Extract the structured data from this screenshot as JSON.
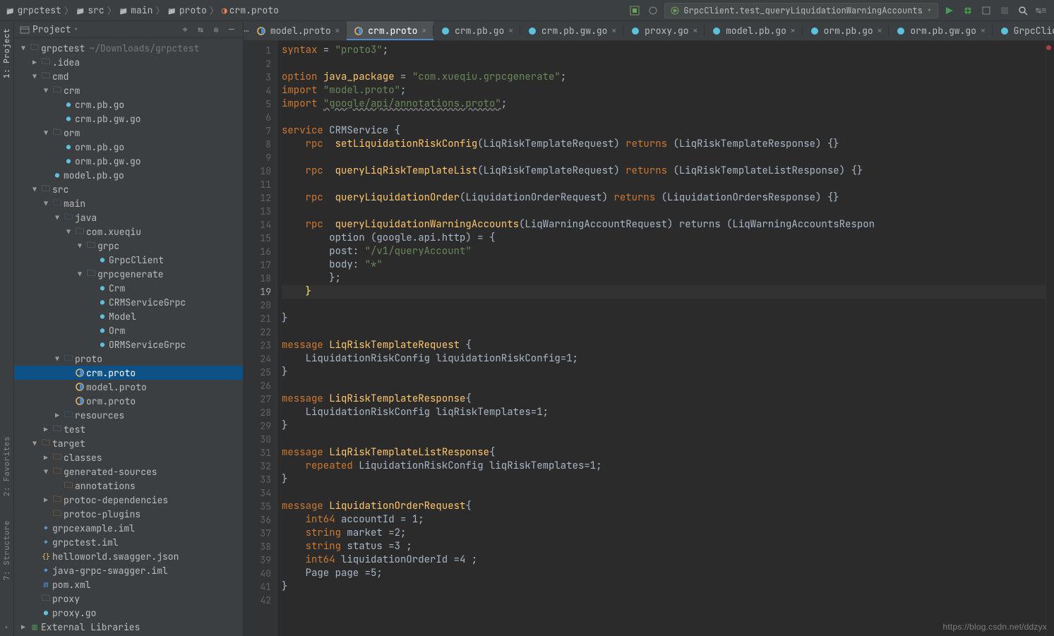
{
  "breadcrumbs": [
    "grpctest",
    "src",
    "main",
    "proto",
    "crm.proto"
  ],
  "runConfig": "GrpcClient.test_queryLiquidationWarningAccounts",
  "sidebar_tabs": {
    "project": "1: Project",
    "favorites": "2: Favorites",
    "structure": "7: Structure"
  },
  "proj_header": {
    "title": "Project"
  },
  "tree": [
    {
      "d": 0,
      "arrow": "▼",
      "ic": "folder",
      "lbl": "grpctest",
      "hint": "~/Downloads/grpctest"
    },
    {
      "d": 1,
      "arrow": "▶",
      "ic": "folder",
      "lbl": ".idea"
    },
    {
      "d": 1,
      "arrow": "▼",
      "ic": "folder",
      "lbl": "cmd"
    },
    {
      "d": 2,
      "arrow": "▼",
      "ic": "folder",
      "lbl": "crm"
    },
    {
      "d": 3,
      "arrow": "",
      "ic": "go",
      "lbl": "crm.pb.go"
    },
    {
      "d": 3,
      "arrow": "",
      "ic": "go",
      "lbl": "crm.pb.gw.go"
    },
    {
      "d": 2,
      "arrow": "▼",
      "ic": "folder",
      "lbl": "orm"
    },
    {
      "d": 3,
      "arrow": "",
      "ic": "go",
      "lbl": "orm.pb.go"
    },
    {
      "d": 3,
      "arrow": "",
      "ic": "go",
      "lbl": "orm.pb.gw.go"
    },
    {
      "d": 2,
      "arrow": "",
      "ic": "go",
      "lbl": "model.pb.go"
    },
    {
      "d": 1,
      "arrow": "▼",
      "ic": "folder",
      "lbl": "src"
    },
    {
      "d": 2,
      "arrow": "▼",
      "ic": "folder-src",
      "lbl": "main"
    },
    {
      "d": 3,
      "arrow": "▼",
      "ic": "folder-src",
      "lbl": "java"
    },
    {
      "d": 4,
      "arrow": "▼",
      "ic": "folder-pkg",
      "lbl": "com.xueqiu"
    },
    {
      "d": 5,
      "arrow": "▼",
      "ic": "folder-pkg",
      "lbl": "grpc"
    },
    {
      "d": 6,
      "arrow": "",
      "ic": "java",
      "lbl": "GrpcClient"
    },
    {
      "d": 5,
      "arrow": "▼",
      "ic": "folder-pkg",
      "lbl": "grpcgenerate"
    },
    {
      "d": 6,
      "arrow": "",
      "ic": "java",
      "lbl": "Crm"
    },
    {
      "d": 6,
      "arrow": "",
      "ic": "java",
      "lbl": "CRMServiceGrpc"
    },
    {
      "d": 6,
      "arrow": "",
      "ic": "java",
      "lbl": "Model"
    },
    {
      "d": 6,
      "arrow": "",
      "ic": "java",
      "lbl": "Orm"
    },
    {
      "d": 6,
      "arrow": "",
      "ic": "java",
      "lbl": "ORMServiceGrpc"
    },
    {
      "d": 3,
      "arrow": "▼",
      "ic": "folder-src",
      "lbl": "proto"
    },
    {
      "d": 4,
      "arrow": "",
      "ic": "proto",
      "lbl": "crm.proto",
      "selected": true
    },
    {
      "d": 4,
      "arrow": "",
      "ic": "proto",
      "lbl": "model.proto"
    },
    {
      "d": 4,
      "arrow": "",
      "ic": "proto",
      "lbl": "orm.proto"
    },
    {
      "d": 3,
      "arrow": "▶",
      "ic": "folder-src",
      "lbl": "resources"
    },
    {
      "d": 2,
      "arrow": "▶",
      "ic": "folder",
      "lbl": "test"
    },
    {
      "d": 1,
      "arrow": "▼",
      "ic": "target",
      "lbl": "target"
    },
    {
      "d": 2,
      "arrow": "▶",
      "ic": "target",
      "lbl": "classes"
    },
    {
      "d": 2,
      "arrow": "▼",
      "ic": "target",
      "lbl": "generated-sources"
    },
    {
      "d": 3,
      "arrow": "",
      "ic": "target",
      "lbl": "annotations"
    },
    {
      "d": 2,
      "arrow": "▶",
      "ic": "target",
      "lbl": "protoc-dependencies"
    },
    {
      "d": 2,
      "arrow": "",
      "ic": "target",
      "lbl": "protoc-plugins"
    },
    {
      "d": 1,
      "arrow": "",
      "ic": "iml",
      "lbl": "grpcexample.iml"
    },
    {
      "d": 1,
      "arrow": "",
      "ic": "iml",
      "lbl": "grpctest.iml"
    },
    {
      "d": 1,
      "arrow": "",
      "ic": "json",
      "lbl": "helloworld.swagger.json"
    },
    {
      "d": 1,
      "arrow": "",
      "ic": "iml",
      "lbl": "java-grpc-swagger.iml"
    },
    {
      "d": 1,
      "arrow": "",
      "ic": "xml",
      "lbl": "pom.xml"
    },
    {
      "d": 1,
      "arrow": "",
      "ic": "folder",
      "lbl": "proxy"
    },
    {
      "d": 1,
      "arrow": "",
      "ic": "go",
      "lbl": "proxy.go"
    },
    {
      "d": 0,
      "arrow": "▶",
      "ic": "lib",
      "lbl": "External Libraries"
    }
  ],
  "tabs": [
    {
      "ic": "proto",
      "lbl": "model.proto"
    },
    {
      "ic": "proto",
      "lbl": "crm.proto",
      "active": true
    },
    {
      "ic": "go",
      "lbl": "crm.pb.go"
    },
    {
      "ic": "go",
      "lbl": "crm.pb.gw.go"
    },
    {
      "ic": "go",
      "lbl": "proxy.go"
    },
    {
      "ic": "go",
      "lbl": "model.pb.go"
    },
    {
      "ic": "go",
      "lbl": "orm.pb.go"
    },
    {
      "ic": "go",
      "lbl": "orm.pb.gw.go"
    },
    {
      "ic": "java",
      "lbl": "GrpcClient.java"
    }
  ],
  "code_lines": [
    {
      "n": 1,
      "html": "<span class='kw'>syntax</span> = <span class='str'>\"proto3\"</span>;"
    },
    {
      "n": 2,
      "html": ""
    },
    {
      "n": 3,
      "html": "<span class='kw'>option</span> <span class='ident'>java_package</span> = <span class='str'>\"com.xueqiu.grpcgenerate\"</span>;"
    },
    {
      "n": 4,
      "html": "<span class='kw'>import</span> <span class='str'>\"model.proto\"</span>;"
    },
    {
      "n": 5,
      "html": "<span class='kw'>import</span> <span class='str' style='text-decoration:underline wavy #808080'>\"google/api/annotations.proto\"</span>;"
    },
    {
      "n": 6,
      "html": ""
    },
    {
      "n": 7,
      "html": "<span class='kw'>service</span> CRMService {"
    },
    {
      "n": 8,
      "html": "    <span class='kw'>rpc</span>  <span class='ident'>setLiquidationRiskConfig</span>(LiqRiskTemplateRequest) <span class='kw'>returns</span> (LiqRiskTemplateResponse) {}"
    },
    {
      "n": 9,
      "html": ""
    },
    {
      "n": 10,
      "html": "    <span class='kw'>rpc</span>  <span class='ident'>queryLiqRiskTemplateList</span>(LiqRiskTemplateRequest) <span class='kw'>returns</span> (LiqRiskTemplateListResponse) {}"
    },
    {
      "n": 11,
      "html": ""
    },
    {
      "n": 12,
      "html": "    <span class='kw'>rpc</span>  <span class='ident'>queryLiquidationOrder</span>(LiquidationOrderRequest) <span class='kw'>returns</span> (LiquidationOrdersResponse) {}"
    },
    {
      "n": 13,
      "html": ""
    },
    {
      "n": 14,
      "html": "    <span class='kw'>rpc</span>  <span class='ident'>queryLiquidationWarningAccounts</span>(LiqWarningAccountRequest) returns (LiqWarningAccountsRespon"
    },
    {
      "n": 15,
      "html": "        option (google.api.http) = {"
    },
    {
      "n": 16,
      "html": "        post: <span class='str'>\"/v1/queryAccount\"</span>"
    },
    {
      "n": 17,
      "html": "        body: <span class='str'>\"*\"</span>"
    },
    {
      "n": 18,
      "html": "        };"
    },
    {
      "n": 19,
      "html": "    <span style='color:#ffef5c'>}</span>",
      "cur": true
    },
    {
      "n": 20,
      "html": ""
    },
    {
      "n": 21,
      "html": "}"
    },
    {
      "n": 22,
      "html": ""
    },
    {
      "n": 23,
      "html": "<span class='kw'>message</span> <span class='ident'>LiqRiskTemplateRequest</span> {"
    },
    {
      "n": 24,
      "html": "    LiquidationRiskConfig liquidationRiskConfig=1;"
    },
    {
      "n": 25,
      "html": "}"
    },
    {
      "n": 26,
      "html": ""
    },
    {
      "n": 27,
      "html": "<span class='kw'>message</span> <span class='ident'>LiqRiskTemplateResponse</span>{"
    },
    {
      "n": 28,
      "html": "    LiquidationRiskConfig liqRiskTemplates=1;"
    },
    {
      "n": 29,
      "html": "}"
    },
    {
      "n": 30,
      "html": ""
    },
    {
      "n": 31,
      "html": "<span class='kw'>message</span> <span class='ident'>LiqRiskTemplateListResponse</span>{"
    },
    {
      "n": 32,
      "html": "    <span class='kw'>repeated</span> LiquidationRiskConfig liqRiskTemplates=1;"
    },
    {
      "n": 33,
      "html": "}"
    },
    {
      "n": 34,
      "html": ""
    },
    {
      "n": 35,
      "html": "<span class='kw'>message</span> <span class='ident'>LiquidationOrderRequest</span>{"
    },
    {
      "n": 36,
      "html": "    <span class='kw'>int64</span> accountId = 1;"
    },
    {
      "n": 37,
      "html": "    <span class='kw'>string</span> market =2;"
    },
    {
      "n": 38,
      "html": "    <span class='kw'>string</span> status =3 ;"
    },
    {
      "n": 39,
      "html": "    <span class='kw'>int64</span> liquidationOrderId =4 ;"
    },
    {
      "n": 40,
      "html": "    Page page =5;"
    },
    {
      "n": 41,
      "html": "}"
    },
    {
      "n": 42,
      "html": ""
    }
  ],
  "watermark": "https://blog.csdn.net/ddzyx"
}
